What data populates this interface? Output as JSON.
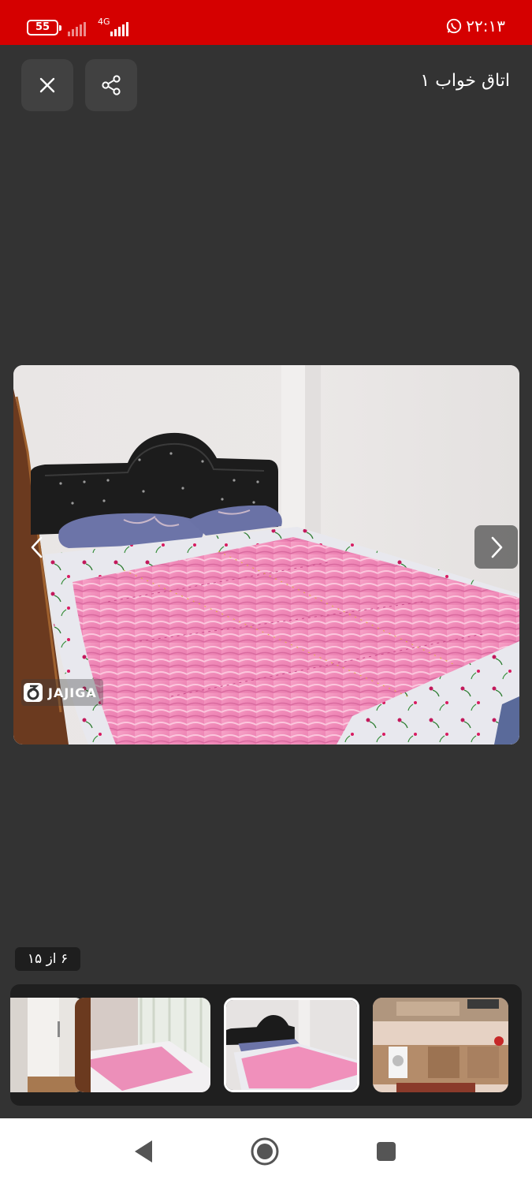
{
  "status_bar": {
    "battery_level": "55",
    "network_type": "4G",
    "time": "۲۲:۱۳",
    "background": "#d50000"
  },
  "header": {
    "title": "اتاق خواب ۱",
    "close_icon": "close-icon",
    "share_icon": "share-icon"
  },
  "photo": {
    "alt_subject": "bedroom with pink quilted bedspread",
    "watermark": "JAJIGA",
    "prev_icon": "chevron-left-icon",
    "next_icon": "chevron-right-icon"
  },
  "counter": {
    "text": "۶ از ۱۵",
    "current": 6,
    "total": 15
  },
  "thumbnails": [
    {
      "subject": "wardrobe",
      "active": false
    },
    {
      "subject": "bedroom with window",
      "active": false
    },
    {
      "subject": "bedroom with black headboard",
      "active": true
    },
    {
      "subject": "kitchen",
      "active": false
    }
  ],
  "nav_bar": {
    "back_icon": "back-triangle-icon",
    "home_icon": "home-circle-icon",
    "recents_icon": "recents-square-icon"
  }
}
